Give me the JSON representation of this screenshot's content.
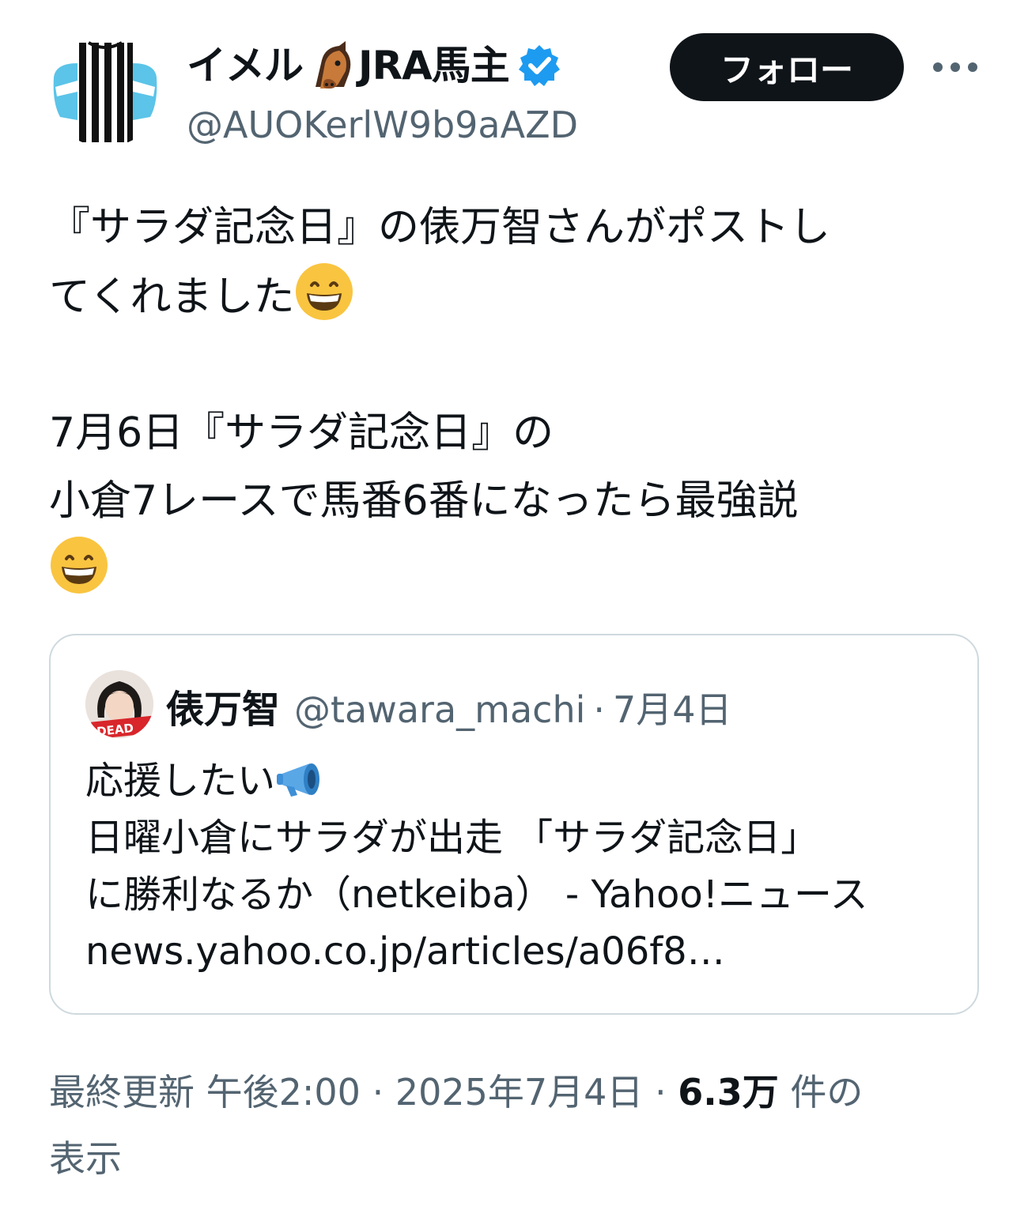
{
  "author": {
    "name_part1": "イメル",
    "name_part2": "JRA馬主",
    "name_emoji": "horse-face",
    "handle": "@AUOKerlW9b9aAZD",
    "verified": true
  },
  "follow_label": "フォロー",
  "tweet": {
    "line1": "『サラダ記念日』の俵万智さんがポストし",
    "line2": "てくれました",
    "line3": "7月6日『サラダ記念日』の",
    "line4": "小倉7レースで馬番6番になったら最強説",
    "emoji": "grinning-face"
  },
  "quote": {
    "name": "俵万智",
    "handle": "@tawara_machi",
    "separator": "·",
    "date": "7月4日",
    "line1": "応援したい",
    "line1_emoji": "megaphone",
    "line2": "日曜小倉にサラダが出走 「サラダ記念日」",
    "line3": "に勝利なるか（netkeiba） - Yahoo!ニュース",
    "line4": "news.yahoo.co.jp/articles/a06f8…",
    "avatar_badge": "DEAD"
  },
  "meta": {
    "label": "最終更新",
    "time": "午後2:00",
    "sep1": "·",
    "date": "2025年7月4日",
    "sep2": "·",
    "views_count": "6.3万",
    "views_suffix": "件の",
    "views_suffix2": "表示"
  },
  "colors": {
    "text": "#0f1419",
    "muted": "#536471",
    "border": "#cfd9de",
    "verified": "#1d9bf0",
    "button_bg": "#0f1419"
  }
}
